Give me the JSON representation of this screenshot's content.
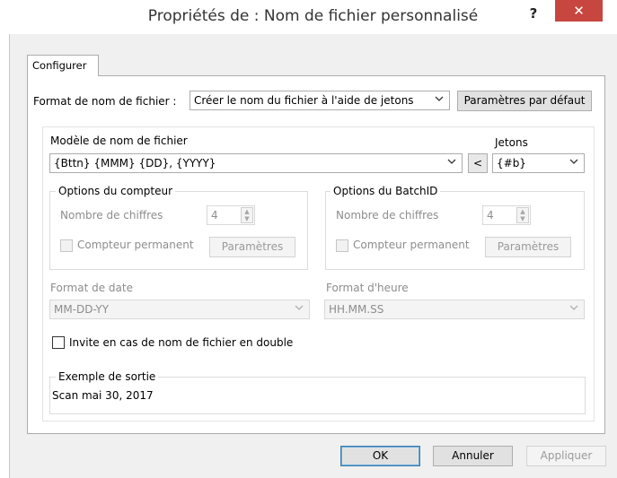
{
  "window": {
    "title": "Propriétés de : Nom de fichier personnalisé",
    "help_glyph": "?",
    "close_glyph": "✕"
  },
  "tabs": [
    {
      "label": "Configurer"
    }
  ],
  "format": {
    "label": "Format de nom de fichier :",
    "value": "Créer le nom du fichier à l'aide de jetons",
    "defaults_button": "Paramètres par défaut"
  },
  "template": {
    "label": "Modèle de nom de fichier",
    "value": "{Bttn} {MMM} {DD}, {YYYY}",
    "insert_button": "<",
    "tokens_label": "Jetons",
    "tokens_value": "{#b}"
  },
  "counter": {
    "title": "Options du compteur",
    "digits_label": "Nombre de chiffres",
    "digits_value": "4",
    "permanent_label": "Compteur permanent",
    "settings_button": "Paramètres"
  },
  "batch": {
    "title": "Options du BatchID",
    "digits_label": "Nombre de chiffres",
    "digits_value": "4",
    "permanent_label": "Compteur permanent",
    "settings_button": "Paramètres"
  },
  "date": {
    "label": "Format de date",
    "value": "MM-DD-YY"
  },
  "time": {
    "label": "Format d'heure",
    "value": "HH.MM.SS"
  },
  "prompt_duplicate": {
    "label": "Invite en cas de nom de fichier en double",
    "checked": false
  },
  "example": {
    "title": "Exemple de sortie",
    "value": "Scan mai 30, 2017"
  },
  "footer": {
    "ok": "OK",
    "cancel": "Annuler",
    "apply": "Appliquer"
  },
  "colors": {
    "close_button": "#c7463f",
    "default_button_border": "#3c7fb1",
    "disabled_text": "#8d8d8d"
  },
  "icons": {
    "dropdown": "chevron-down-icon",
    "spin_up": "caret-up-icon",
    "spin_down": "caret-down-icon"
  }
}
